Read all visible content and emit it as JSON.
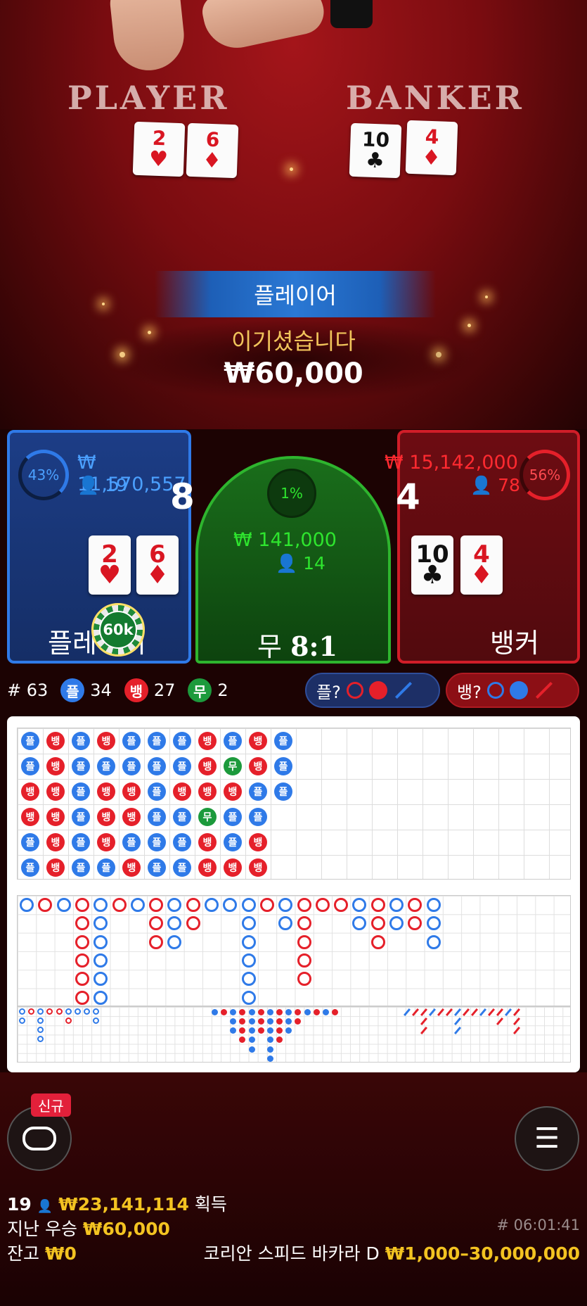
{
  "table": {
    "player_label": "PLAYER",
    "banker_label": "BANKER",
    "player_cards": [
      {
        "rank": "2",
        "suit": "♥",
        "color": "red"
      },
      {
        "rank": "6",
        "suit": "♦",
        "color": "red"
      }
    ],
    "banker_cards": [
      {
        "rank": "10",
        "suit": "♣",
        "color": "black"
      },
      {
        "rank": "4",
        "suit": "♦",
        "color": "red"
      }
    ]
  },
  "result": {
    "winner": "플레이어",
    "message": "이기셨습니다",
    "amount": "₩60,000"
  },
  "bets": {
    "player": {
      "percent": "43%",
      "amount": "₩ 11,570,557",
      "count": "19",
      "score": "8",
      "label": "플레이어",
      "color": "#2f7ae8"
    },
    "tie": {
      "percent": "1%",
      "amount": "₩ 141,000",
      "count": "14",
      "label": "무",
      "payout": "8:1",
      "color": "#2ee52e"
    },
    "banker": {
      "percent": "56%",
      "amount": "₩ 15,142,000",
      "count": "78",
      "score": "4",
      "label": "뱅커",
      "color": "#e5202a"
    },
    "chip": "60k"
  },
  "stats": {
    "round": "# 63",
    "player_glyph": "플",
    "player_count": "34",
    "banker_glyph": "뱅",
    "banker_count": "27",
    "tie_glyph": "무",
    "tie_count": "2",
    "player_predict": "플?",
    "banker_predict": "뱅?"
  },
  "bead_road": [
    [
      "P",
      "B",
      "P",
      "B",
      "P",
      "P",
      "P",
      "B",
      "P",
      "B",
      "P"
    ],
    [
      "P",
      "B",
      "P",
      "P",
      "P",
      "P",
      "P",
      "B",
      "T",
      "B",
      "P"
    ],
    [
      "B",
      "B",
      "P",
      "B",
      "B",
      "P",
      "B",
      "B",
      "B",
      "P",
      "P"
    ],
    [
      "B",
      "B",
      "P",
      "B",
      "B",
      "P",
      "P",
      "T",
      "P",
      "P"
    ],
    [
      "P",
      "B",
      "P",
      "B",
      "P",
      "P",
      "P",
      "B",
      "P",
      "B"
    ],
    [
      "P",
      "B",
      "P",
      "P",
      "B",
      "P",
      "P",
      "B",
      "B",
      "B"
    ]
  ],
  "glyphs": {
    "P": "플",
    "B": "뱅",
    "T": "무"
  },
  "big_road": [
    [
      "P"
    ],
    [
      "B"
    ],
    [
      "P"
    ],
    [
      "B",
      "B",
      "B",
      "B",
      "B",
      "B"
    ],
    [
      "P",
      "P",
      "P",
      "P",
      "P",
      "P"
    ],
    [
      "B"
    ],
    [
      "P"
    ],
    [
      "B",
      "B",
      "B"
    ],
    [
      "P",
      "P",
      "P"
    ],
    [
      "B",
      "B"
    ],
    [
      "P"
    ],
    [
      "P"
    ],
    [
      "P",
      "P",
      "P",
      "P",
      "P",
      "P"
    ],
    [
      "B"
    ],
    [
      "P",
      "P"
    ],
    [
      "B",
      "B",
      "B",
      "B",
      "B"
    ],
    [
      "B"
    ],
    [
      "B"
    ],
    [
      "P",
      "P"
    ],
    [
      "B",
      "B",
      "B"
    ],
    [
      "P",
      "P"
    ],
    [
      "B",
      "B"
    ],
    [
      "P",
      "P",
      "P"
    ]
  ],
  "footer": {
    "new_badge": "신규",
    "players": "19",
    "total_won": "₩23,141,114",
    "won_label": "획득",
    "last_win_label": "지난 우승",
    "last_win": "₩60,000",
    "balance_label": "잔고",
    "balance": "₩0",
    "game_id": "# 06:01:41",
    "table_name": "코리안 스피드 바카라 D",
    "limits": "₩1,000–30,000,000"
  }
}
